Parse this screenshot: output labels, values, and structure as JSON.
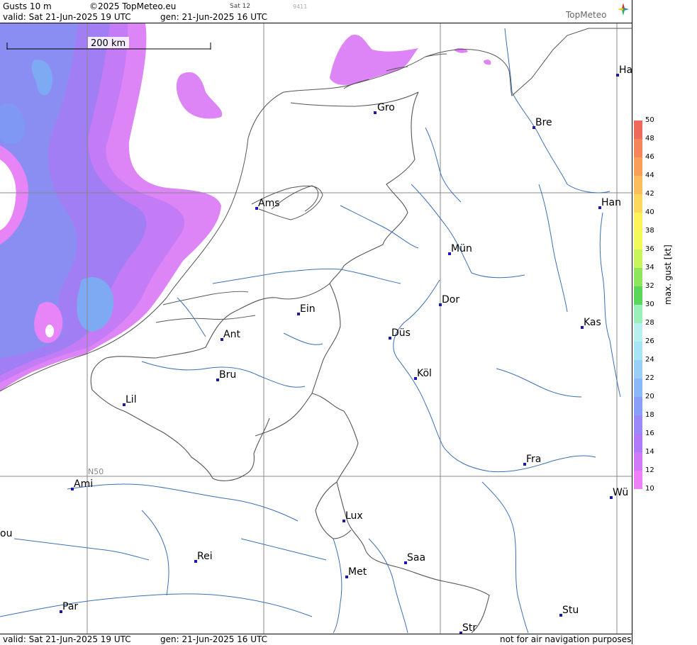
{
  "header": {
    "product": "Gusts 10 m",
    "copyright": "©2025 TopMeteo.eu",
    "valid": "valid:  Sat  21-Jun-2025  19 UTC",
    "gen": "gen: 21-Jun-2025 16 UTC",
    "code1": "Sat 12",
    "code2": "9411",
    "logo": "TopMeteo"
  },
  "footer": {
    "valid": "valid:  Sat  21-Jun-2025  19 UTC",
    "gen": "gen: 21-Jun-2025 16 UTC",
    "disclaimer": "not for air navigation purposes"
  },
  "map": {
    "scale_label": "200 km",
    "latitude_label": "N50",
    "cities": [
      {
        "name": "Gro"
      },
      {
        "name": "Ha"
      },
      {
        "name": "Bre"
      },
      {
        "name": "Ams"
      },
      {
        "name": "Han"
      },
      {
        "name": "Mün"
      },
      {
        "name": "Dor"
      },
      {
        "name": "Ein"
      },
      {
        "name": "Kas"
      },
      {
        "name": "Ant"
      },
      {
        "name": "Düs"
      },
      {
        "name": "Köl"
      },
      {
        "name": "Bru"
      },
      {
        "name": "Lil"
      },
      {
        "name": "Fra"
      },
      {
        "name": "Ami"
      },
      {
        "name": "Wü"
      },
      {
        "name": "Lux"
      },
      {
        "name": "ou"
      },
      {
        "name": "Rei"
      },
      {
        "name": "Saa"
      },
      {
        "name": "Met"
      },
      {
        "name": "Par"
      },
      {
        "name": "Stu"
      },
      {
        "name": "Str"
      }
    ]
  },
  "legend": {
    "title": "max. gust [kt]",
    "ticks": [
      "50",
      "48",
      "46",
      "44",
      "42",
      "40",
      "38",
      "36",
      "34",
      "32",
      "30",
      "28",
      "26",
      "24",
      "22",
      "20",
      "18",
      "16",
      "14",
      "12",
      "10"
    ],
    "colors": [
      "#f06a5a",
      "#f5845a",
      "#f8a05a",
      "#fbbe5a",
      "#fdd85a",
      "#fff35a",
      "#f0fb5a",
      "#c8f55a",
      "#8ee65a",
      "#5ad65a",
      "#9af0b8",
      "#b8f0f0",
      "#a8e4f8",
      "#9ad0f8",
      "#8ab8f8",
      "#8aa0f8",
      "#9a8af8",
      "#b07af8",
      "#d07af8",
      "#ee80f8"
    ]
  }
}
